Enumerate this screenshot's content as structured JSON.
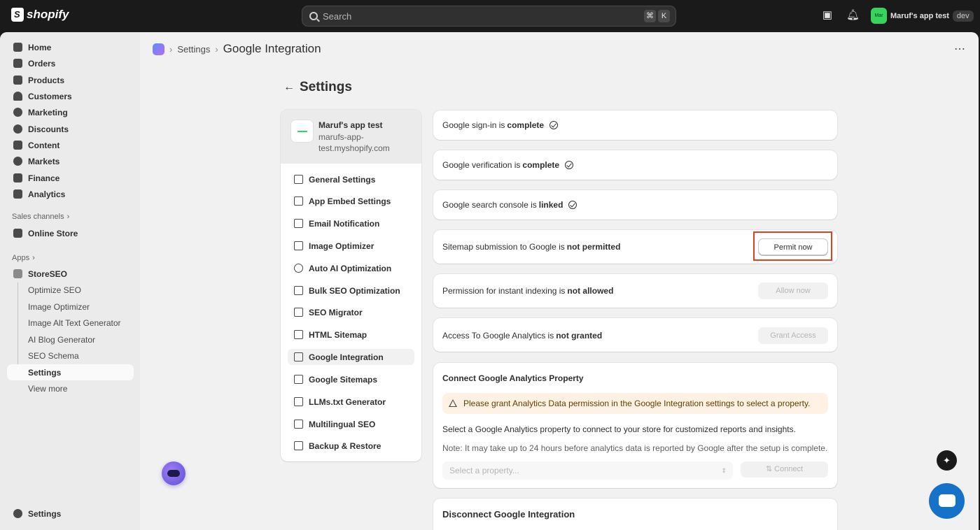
{
  "topbar": {
    "logo": "shopify",
    "search_placeholder": "Search",
    "kbd_cmd": "⌘",
    "kbd_k": "K",
    "store_avatar": "Mar",
    "store_name": "Maruf's app test",
    "store_badge": "dev"
  },
  "sidebar": {
    "items": [
      {
        "label": "Home",
        "icon": "home-icon"
      },
      {
        "label": "Orders",
        "icon": "orders-icon"
      },
      {
        "label": "Products",
        "icon": "tag-icon"
      },
      {
        "label": "Customers",
        "icon": "person-icon"
      },
      {
        "label": "Marketing",
        "icon": "target-icon"
      },
      {
        "label": "Discounts",
        "icon": "discount-icon"
      },
      {
        "label": "Content",
        "icon": "content-icon"
      },
      {
        "label": "Markets",
        "icon": "globe-icon"
      },
      {
        "label": "Finance",
        "icon": "bank-icon"
      },
      {
        "label": "Analytics",
        "icon": "chart-icon"
      }
    ],
    "sales_channels_label": "Sales channels",
    "online_store": "Online Store",
    "apps_label": "Apps",
    "storeseo": "StoreSEO",
    "storeseo_sub": [
      "Optimize SEO",
      "Image Optimizer",
      "Image Alt Text Generator",
      "AI Blog Generator",
      "SEO Schema",
      "Settings",
      "View more"
    ],
    "settings": "Settings"
  },
  "breadcrumb": {
    "parent": "Settings",
    "current": "Google Integration"
  },
  "page_title": "Settings",
  "store_card": {
    "name": "Maruf's app test",
    "domain": "marufs-app-test.myshopify.com"
  },
  "menu": [
    "General Settings",
    "App Embed Settings",
    "Email Notification",
    "Image Optimizer",
    "Auto AI Optimization",
    "Bulk SEO Optimization",
    "SEO Migrator",
    "HTML Sitemap",
    "Google Integration",
    "Google Sitemaps",
    "LLMs.txt Generator",
    "Multilingual SEO",
    "Backup & Restore"
  ],
  "status_cards": {
    "signin": {
      "prefix": "Google sign-in is",
      "status": "complete"
    },
    "verification": {
      "prefix": "Google verification is",
      "status": "complete"
    },
    "console": {
      "prefix": "Google search console is",
      "status": "linked"
    },
    "sitemap": {
      "prefix": "Sitemap submission to Google is",
      "status": "not permitted",
      "button": "Permit now"
    },
    "indexing": {
      "prefix": "Permission for instant indexing is",
      "status": "not allowed",
      "button": "Allow now"
    },
    "analytics": {
      "prefix": "Access To Google Analytics is",
      "status": "not granted",
      "button": "Grant Access"
    }
  },
  "ga_card": {
    "title": "Connect Google Analytics Property",
    "warning": "Please grant Analytics Data permission in the Google Integration settings to select a property.",
    "description": "Select a Google Analytics property to connect to your store for customized reports and insights.",
    "note": "Note: It may take up to 24 hours before analytics data is reported by Google after the setup is complete.",
    "select_placeholder": "Select a property...",
    "connect": "Connect"
  },
  "disconnect_title": "Disconnect Google Integration"
}
